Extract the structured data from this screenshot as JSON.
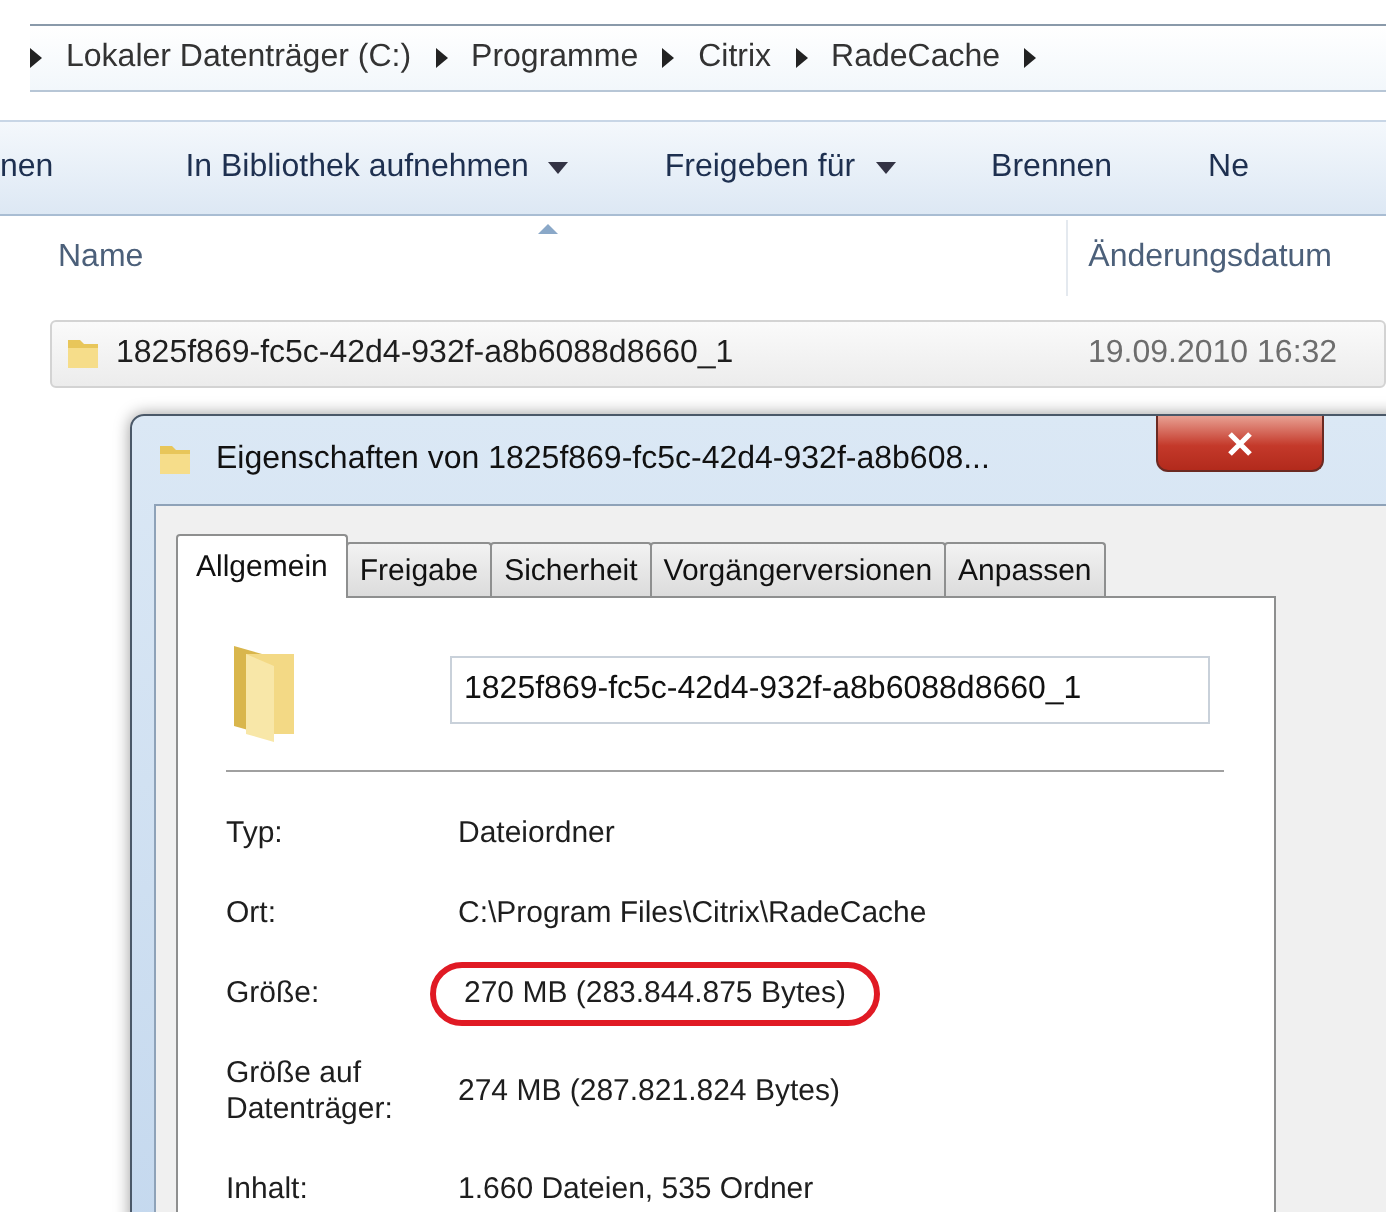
{
  "address_bar": {
    "segments": [
      "Lokaler Datenträger (C:)",
      "Programme",
      "Citrix",
      "RadeCache"
    ]
  },
  "toolbar": {
    "items": [
      {
        "label": "nen",
        "dropdown": false
      },
      {
        "label": "In Bibliothek aufnehmen",
        "dropdown": true
      },
      {
        "label": "Freigeben für",
        "dropdown": true
      },
      {
        "label": "Brennen",
        "dropdown": false
      },
      {
        "label": "Ne",
        "dropdown": false
      }
    ]
  },
  "file_list": {
    "columns": [
      {
        "label": "Name",
        "sorted": true
      },
      {
        "label": "Änderungsdatum",
        "sorted": false
      }
    ],
    "rows": [
      {
        "name": "1825f869-fc5c-42d4-932f-a8b6088d8660_1",
        "date": "19.09.2010 16:32",
        "selected": true
      }
    ]
  },
  "dialog": {
    "title": "Eigenschaften von 1825f869-fc5c-42d4-932f-a8b608...",
    "tabs": [
      {
        "label": "Allgemein",
        "selected": true
      },
      {
        "label": "Freigabe",
        "selected": false
      },
      {
        "label": "Sicherheit",
        "selected": false
      },
      {
        "label": "Vorgängerversionen",
        "selected": false
      },
      {
        "label": "Anpassen",
        "selected": false
      }
    ],
    "name_field": {
      "value": "1825f869-fc5c-42d4-932f-a8b6088d8660_1"
    },
    "properties": [
      {
        "label": "Typ:",
        "value": "Dateiordner",
        "circled": false
      },
      {
        "label": "Ort:",
        "value": "C:\\Program Files\\Citrix\\RadeCache",
        "circled": false
      },
      {
        "label": "Größe:",
        "value": "270 MB (283.844.875 Bytes)",
        "circled": true
      },
      {
        "label": "Größe auf Datenträger:",
        "value": "274 MB (287.821.824 Bytes)",
        "circled": false
      },
      {
        "label": "Inhalt:",
        "value": "1.660 Dateien, 535 Ordner",
        "circled": false
      }
    ]
  }
}
